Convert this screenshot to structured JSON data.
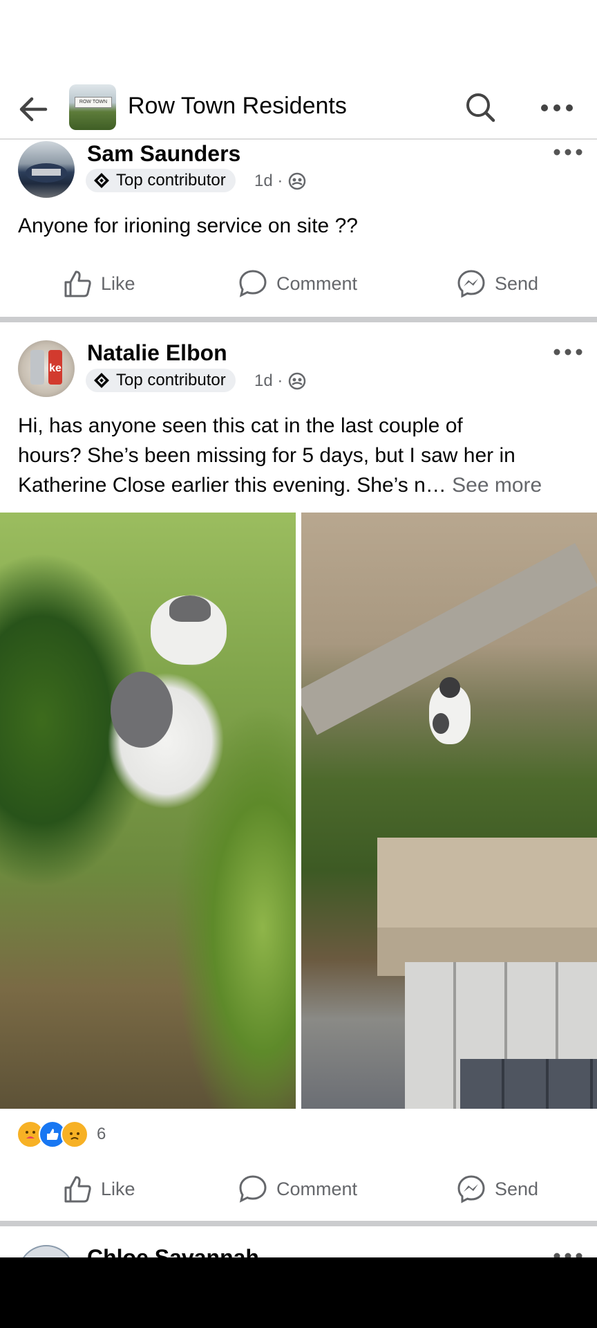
{
  "header": {
    "group_name": "Row Town Residents",
    "group_sign_text": "ROW TOWN"
  },
  "posts": [
    {
      "author": "Sam Saunders",
      "badge": "Top contributor",
      "time": "1d ·",
      "text": "Anyone for irioning service on site ??",
      "actions": {
        "like": "Like",
        "comment": "Comment",
        "send": "Send"
      }
    },
    {
      "author": "Natalie Elbon",
      "badge": "Top contributor",
      "time": "1d ·",
      "text_line1": "Hi, has anyone seen this cat in the last couple of",
      "text_line2": "hours? She’s been missing for 5 days, but I saw her in",
      "text_line3": "Katherine Close earlier this evening. She’s n…",
      "see_more": "See more",
      "reactions": {
        "icons": [
          "care",
          "like",
          "sad"
        ],
        "count": "6"
      },
      "actions": {
        "like": "Like",
        "comment": "Comment",
        "send": "Send"
      }
    },
    {
      "author": "Chloe Savannah"
    }
  ],
  "colors": {
    "secondary_text": "#65676b",
    "like_blue": "#1877f2",
    "separator": "#cbccce"
  }
}
